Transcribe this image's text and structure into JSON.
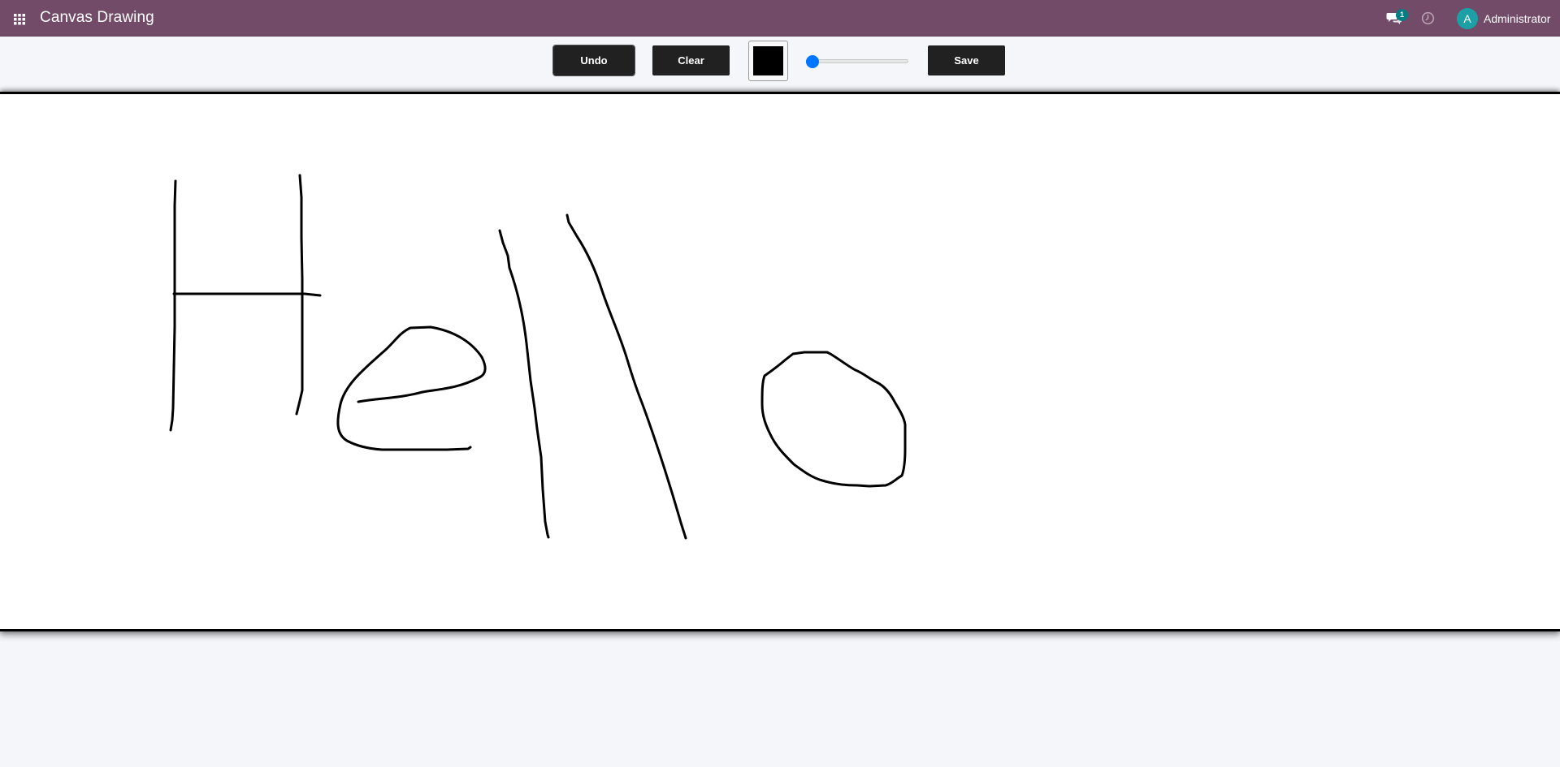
{
  "navbar": {
    "brand": "Canvas Drawing",
    "chat_badge_count": "1",
    "user": {
      "avatar_initial": "A",
      "name": "Administrator"
    },
    "icons": {
      "apps": "apps-grid-icon",
      "chat": "chat-bubbles-icon",
      "activity": "clock-icon"
    }
  },
  "toolbar": {
    "undo_label": "Undo",
    "clear_label": "Clear",
    "save_label": "Save",
    "brush_color": "#000000",
    "brush_size": {
      "value": 1,
      "min": 1,
      "max": 50
    }
  },
  "colors": {
    "navbar_bg": "#714b67",
    "page_bg": "#f5f6fa",
    "button_bg": "#212121",
    "slider_accent": "#0075ff",
    "badge_bg": "#017e84",
    "avatar_bg": "#1d9fa6",
    "canvas_bg": "#ffffff",
    "stroke_color": "#000000"
  }
}
